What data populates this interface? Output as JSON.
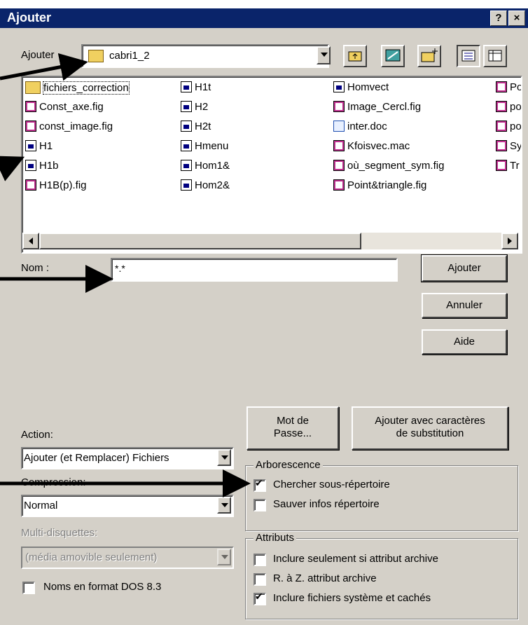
{
  "window": {
    "title": "Ajouter",
    "help_btn": "?",
    "close_btn": "×"
  },
  "look_in": {
    "label": "Ajouter",
    "value": "cabri1_2"
  },
  "toolbar": [
    "up-folder-icon",
    "desktop-icon",
    "new-folder-icon",
    "list-view-icon",
    "details-view-icon"
  ],
  "files": {
    "col1": [
      {
        "name": "fichiers_correction",
        "icon": "folder"
      },
      {
        "name": "Const_axe.fig",
        "icon": "fig"
      },
      {
        "name": "const_image.fig",
        "icon": "fig"
      },
      {
        "name": "H1",
        "icon": "app"
      },
      {
        "name": "H1b",
        "icon": "app"
      },
      {
        "name": "H1B(p).fig",
        "icon": "fig"
      }
    ],
    "col2": [
      {
        "name": "H1t",
        "icon": "app"
      },
      {
        "name": "H2",
        "icon": "app"
      },
      {
        "name": "H2t",
        "icon": "app"
      },
      {
        "name": "Hmenu",
        "icon": "app"
      },
      {
        "name": "Hom1&",
        "icon": "app"
      },
      {
        "name": "Hom2&",
        "icon": "app"
      }
    ],
    "col3": [
      {
        "name": "Homvect",
        "icon": "app"
      },
      {
        "name": "Image_Cercl.fig",
        "icon": "fig"
      },
      {
        "name": "inter.doc",
        "icon": "doc"
      },
      {
        "name": "Kfoisvec.mac",
        "icon": "fig"
      },
      {
        "name": "où_segment_sym.fig",
        "icon": "fig"
      },
      {
        "name": "Point&triangle.fig",
        "icon": "fig"
      }
    ],
    "col4": [
      {
        "name": "Po",
        "icon": "fig"
      },
      {
        "name": "pol",
        "icon": "fig"
      },
      {
        "name": "pol",
        "icon": "fig"
      },
      {
        "name": "Sy",
        "icon": "fig"
      },
      {
        "name": "Tr",
        "icon": "fig"
      }
    ]
  },
  "name_field": {
    "label": "Nom :",
    "value": "*.*"
  },
  "buttons": {
    "add": "Ajouter",
    "cancel": "Annuler",
    "help": "Aide",
    "password_line1": "Mot de",
    "password_line2": "Passe...",
    "wildcard_line1": "Ajouter avec caractères",
    "wildcard_line2": "de substitution"
  },
  "action": {
    "label": "Action:",
    "value": "Ajouter (et Remplacer) Fichiers"
  },
  "compression": {
    "label": "Compression:",
    "value": "Normal"
  },
  "multidisk": {
    "label": "Multi-disquettes:",
    "value": "(média amovible seulement)"
  },
  "dos_names": {
    "label": "Noms en format DOS 8.3",
    "checked": false
  },
  "tree_group": {
    "title": "Arborescence",
    "items": [
      {
        "label": "Chercher sous-répertoire",
        "checked": true
      },
      {
        "label": "Sauver infos répertoire",
        "checked": false
      }
    ]
  },
  "attr_group": {
    "title": "Attributs",
    "items": [
      {
        "label": "Inclure seulement si attribut archive",
        "checked": false
      },
      {
        "label": "R. à Z. attribut archive",
        "checked": false
      },
      {
        "label": "Inclure fichiers système et cachés",
        "checked": true
      }
    ]
  }
}
